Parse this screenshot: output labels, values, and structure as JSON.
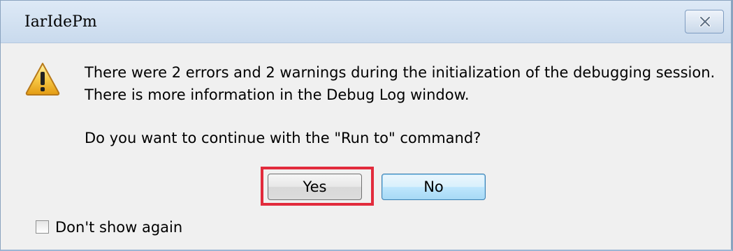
{
  "window": {
    "title": "IarIdePm",
    "close_icon": "close-icon"
  },
  "message": {
    "icon": "warning-icon",
    "line1": "There were 2 errors and 2 warnings during the initialization of the debugging session.",
    "line2": "There is more information in the Debug Log window.",
    "question": "Do you want to continue with the \"Run to\" command?"
  },
  "buttons": {
    "yes_label": "Yes",
    "no_label": "No"
  },
  "options": {
    "dont_show_again_label": "Don't show again",
    "dont_show_again_checked": false
  },
  "colors": {
    "highlight": "#e22b3c",
    "title_bar": "#d4e2f2"
  }
}
